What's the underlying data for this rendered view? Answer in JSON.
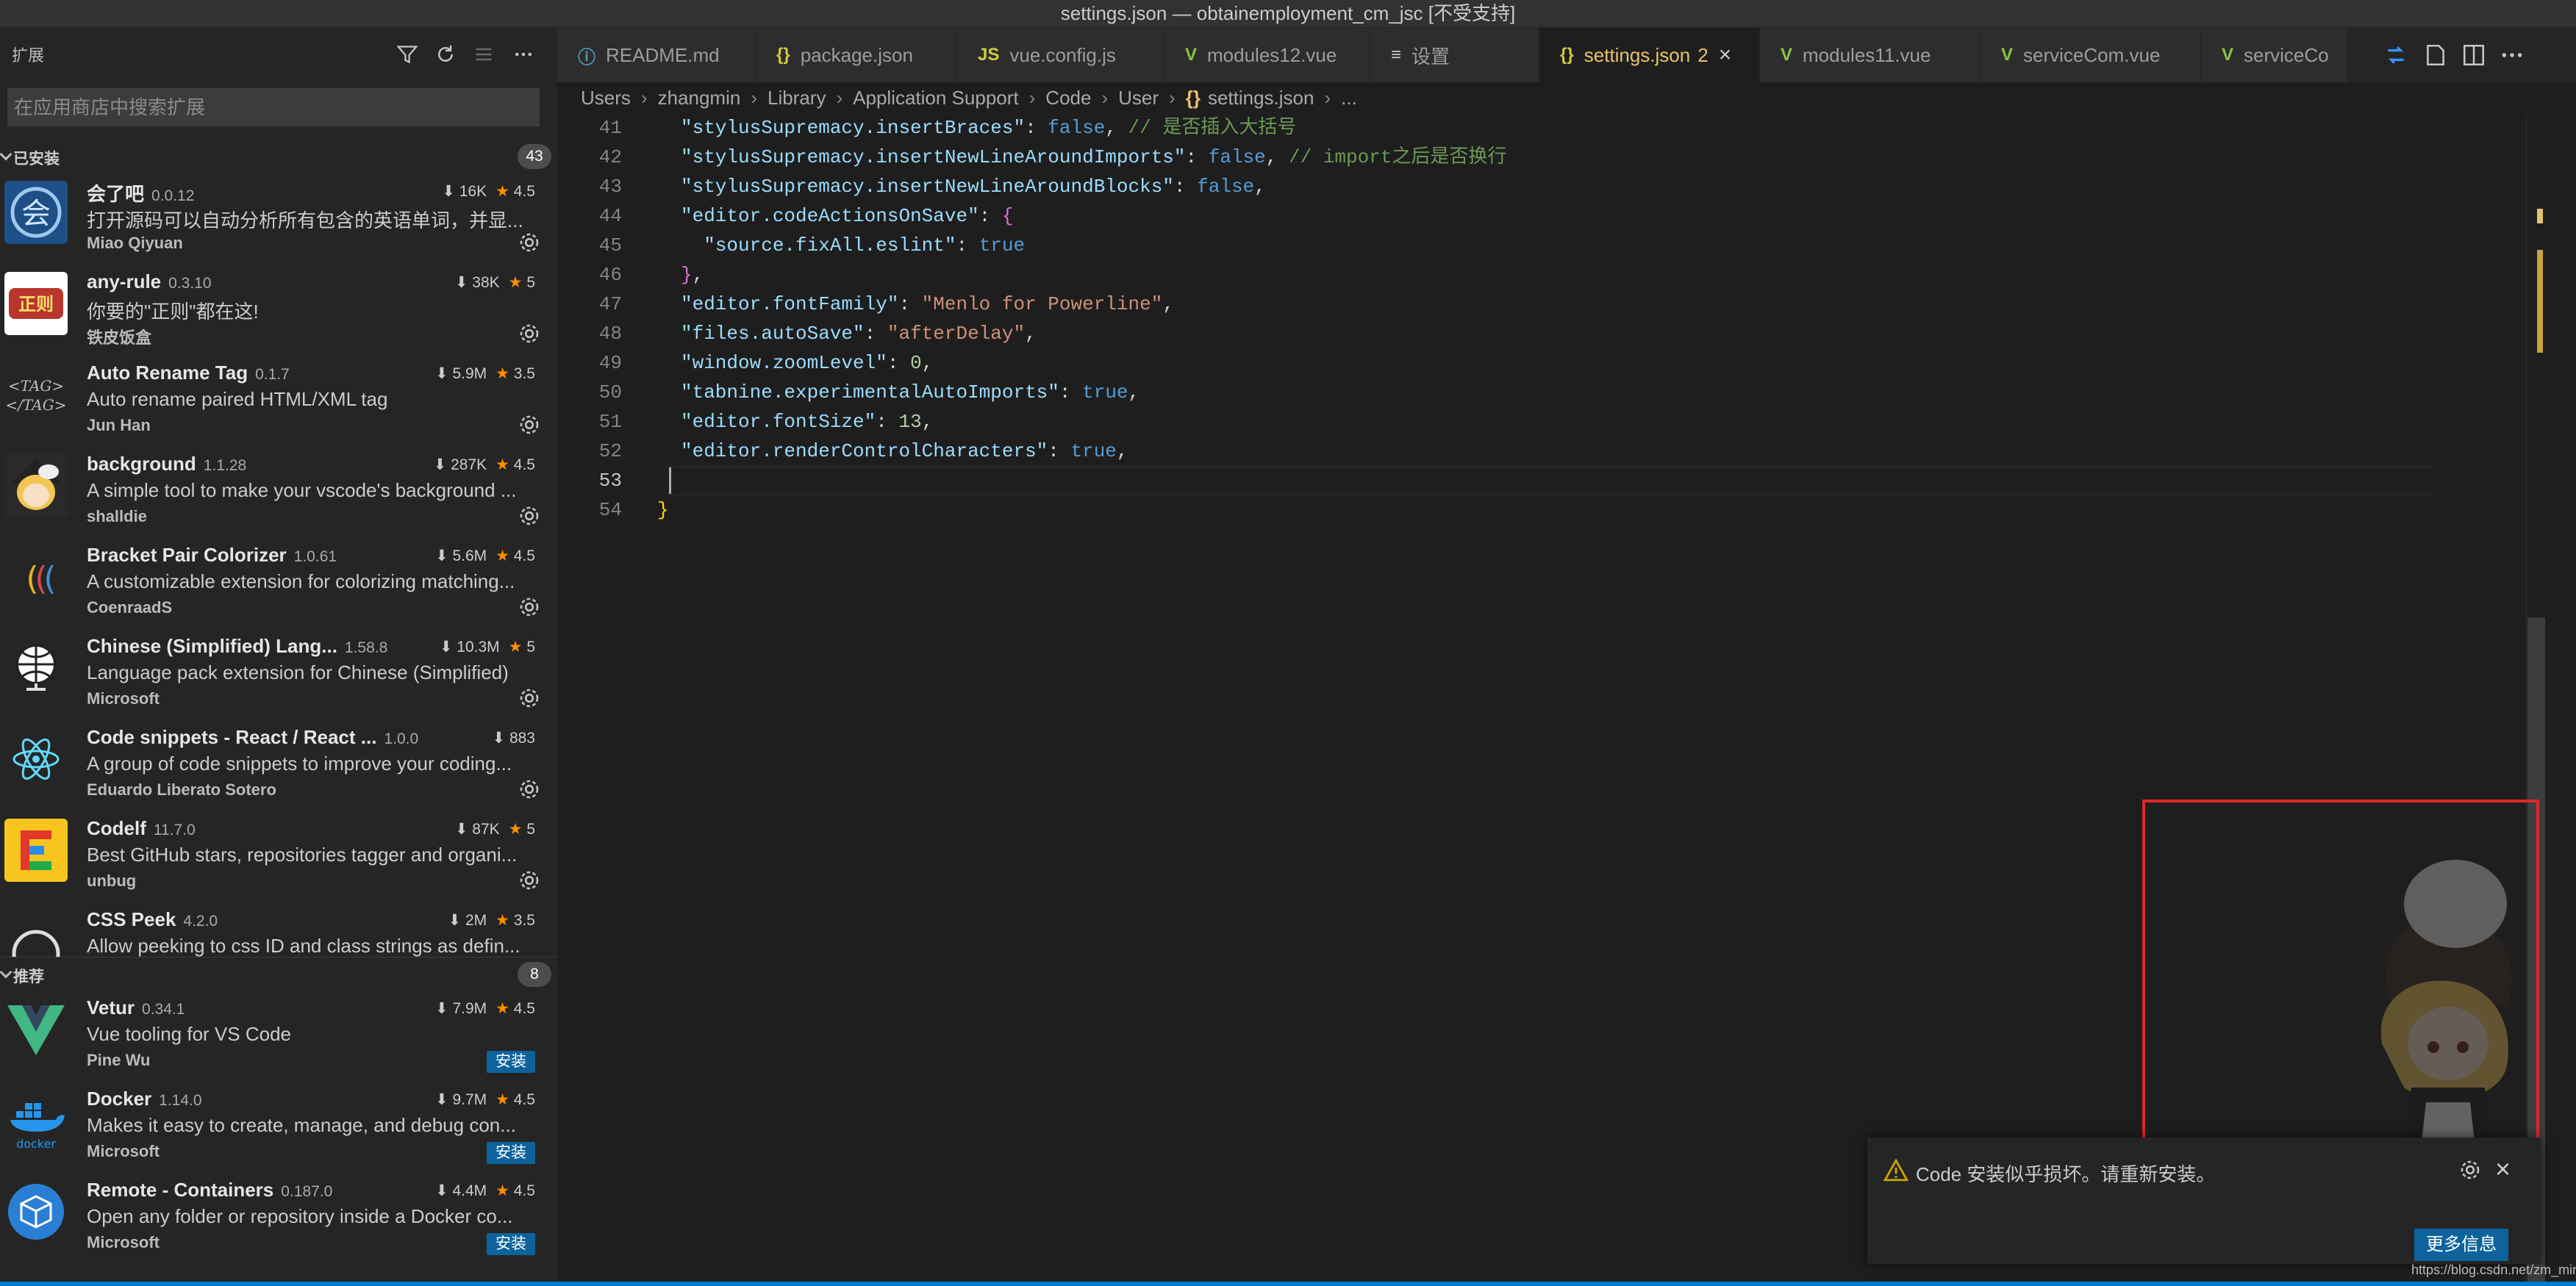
{
  "window": {
    "title": "settings.json — obtainemployment_cm_jsc [不受支持]"
  },
  "sidebar": {
    "title": "扩展",
    "search_placeholder": "在应用商店中搜索扩展",
    "installed": {
      "label": "已安装",
      "count": "43",
      "items": [
        {
          "name": "会了吧",
          "version": "0.0.12",
          "downloads": "16K",
          "rating": "4.5",
          "description": "打开源码可以自动分析所有包含的英语单词，并显...",
          "publisher": "Miao Qiyuan",
          "icon": "hui-le-ba-icon"
        },
        {
          "name": "any-rule",
          "version": "0.3.10",
          "downloads": "38K",
          "rating": "5",
          "description": "你要的\"正则\"都在这!",
          "publisher": "铁皮饭盒",
          "icon": "any-rule-icon"
        },
        {
          "name": "Auto Rename Tag",
          "version": "0.1.7",
          "downloads": "5.9M",
          "rating": "3.5",
          "description": "Auto rename paired HTML/XML tag",
          "publisher": "Jun Han",
          "icon": "tag-icon"
        },
        {
          "name": "background",
          "version": "1.1.28",
          "downloads": "287K",
          "rating": "4.5",
          "description": "A simple tool to make your vscode's background ...",
          "publisher": "shalldie",
          "icon": "anime-girl-icon"
        },
        {
          "name": "Bracket Pair Colorizer",
          "version": "1.0.61",
          "downloads": "5.6M",
          "rating": "4.5",
          "description": "A customizable extension for colorizing matching...",
          "publisher": "CoenraadS",
          "icon": "bracket-icon"
        },
        {
          "name": "Chinese (Simplified) Lang...",
          "version": "1.58.8",
          "downloads": "10.3M",
          "rating": "5",
          "description": "Language pack extension for Chinese (Simplified)",
          "publisher": "Microsoft",
          "icon": "globe-icon"
        },
        {
          "name": "Code snippets - React / React ...",
          "version": "1.0.0",
          "downloads": "883",
          "rating": "",
          "description": "A group of code snippets to improve your coding...",
          "publisher": "Eduardo Liberato Sotero",
          "icon": "react-icon"
        },
        {
          "name": "Codelf",
          "version": "11.7.0",
          "downloads": "87K",
          "rating": "5",
          "description": "Best GitHub stars, repositories tagger and organi...",
          "publisher": "unbug",
          "icon": "codelf-icon"
        },
        {
          "name": "CSS Peek",
          "version": "4.2.0",
          "downloads": "2M",
          "rating": "3.5",
          "description": "Allow peeking to css ID and class strings as defin...",
          "publisher": "",
          "icon": "css-peek-icon"
        }
      ]
    },
    "recommended": {
      "label": "推荐",
      "count": "8",
      "install_label": "安装",
      "items": [
        {
          "name": "Vetur",
          "version": "0.34.1",
          "downloads": "7.9M",
          "rating": "4.5",
          "description": "Vue tooling for VS Code",
          "publisher": "Pine Wu",
          "icon": "vue-icon"
        },
        {
          "name": "Docker",
          "version": "1.14.0",
          "downloads": "9.7M",
          "rating": "4.5",
          "description": "Makes it easy to create, manage, and debug con...",
          "publisher": "Microsoft",
          "icon": "docker-icon"
        },
        {
          "name": "Remote - Containers",
          "version": "0.187.0",
          "downloads": "4.4M",
          "rating": "4.5",
          "description": "Open any folder or repository inside a Docker co...",
          "publisher": "Microsoft",
          "icon": "container-icon"
        }
      ]
    }
  },
  "tabs": [
    {
      "label": "README.md",
      "icon": "ⓘ",
      "icon_color": "#519aba"
    },
    {
      "label": "package.json",
      "icon": "{}",
      "icon_color": "#cbcb41"
    },
    {
      "label": "vue.config.js",
      "icon": "JS",
      "icon_color": "#cbcb41"
    },
    {
      "label": "modules12.vue",
      "icon": "V",
      "icon_color": "#8dc149"
    },
    {
      "label": "设置",
      "icon": "≡",
      "icon_color": "#cccccc"
    },
    {
      "label": "settings.json",
      "icon": "{}",
      "icon_color": "#cbcb41",
      "problems": "2",
      "active": true
    },
    {
      "label": "modules11.vue",
      "icon": "V",
      "icon_color": "#8dc149"
    },
    {
      "label": "serviceCom.vue",
      "icon": "V",
      "icon_color": "#8dc149"
    },
    {
      "label": "serviceCo",
      "icon": "V",
      "icon_color": "#8dc149"
    }
  ],
  "breadcrumb": [
    "Users",
    "zhangmin",
    "Library",
    "Application Support",
    "Code",
    "User",
    "settings.json",
    "..."
  ],
  "editor": {
    "lines": [
      {
        "n": "41",
        "tokens": [
          [
            "k",
            "\"stylusSupremacy.insertBraces\""
          ],
          [
            "p",
            ": "
          ],
          [
            "b",
            "false"
          ],
          [
            "p",
            ", "
          ],
          [
            "c",
            "// 是否插入大括号"
          ]
        ]
      },
      {
        "n": "42",
        "tokens": [
          [
            "k",
            "\"stylusSupremacy.insertNewLineAroundImports\""
          ],
          [
            "p",
            ": "
          ],
          [
            "b",
            "false"
          ],
          [
            "p",
            ", "
          ],
          [
            "c",
            "// import之后是否换行"
          ]
        ]
      },
      {
        "n": "43",
        "tokens": [
          [
            "k",
            "\"stylusSupremacy.insertNewLineAroundBlocks\""
          ],
          [
            "p",
            ": "
          ],
          [
            "b",
            "false"
          ],
          [
            "p",
            ","
          ]
        ]
      },
      {
        "n": "44",
        "tokens": [
          [
            "k",
            "\"editor.codeActionsOnSave\""
          ],
          [
            "p",
            ": "
          ],
          [
            "br2",
            "{"
          ]
        ]
      },
      {
        "n": "45",
        "tokens": [
          [
            "p",
            "  "
          ],
          [
            "k",
            "\"source.fixAll.eslint\""
          ],
          [
            "p",
            ": "
          ],
          [
            "b",
            "true"
          ]
        ]
      },
      {
        "n": "46",
        "tokens": [
          [
            "br2",
            "}"
          ],
          [
            "p",
            ","
          ]
        ]
      },
      {
        "n": "47",
        "tokens": [
          [
            "k",
            "\"editor.fontFamily\""
          ],
          [
            "p",
            ": "
          ],
          [
            "s",
            "\"Menlo for Powerline\""
          ],
          [
            "p",
            ","
          ]
        ]
      },
      {
        "n": "48",
        "tokens": [
          [
            "k",
            "\"files.autoSave\""
          ],
          [
            "p",
            ": "
          ],
          [
            "s",
            "\"afterDelay\""
          ],
          [
            "p",
            ","
          ]
        ]
      },
      {
        "n": "49",
        "tokens": [
          [
            "k",
            "\"window.zoomLevel\""
          ],
          [
            "p",
            ": "
          ],
          [
            "num",
            "0"
          ],
          [
            "p",
            ","
          ]
        ]
      },
      {
        "n": "50",
        "tokens": [
          [
            "k",
            "\"tabnine.experimentalAutoImports\""
          ],
          [
            "p",
            ": "
          ],
          [
            "b",
            "true"
          ],
          [
            "p",
            ","
          ]
        ]
      },
      {
        "n": "51",
        "tokens": [
          [
            "k",
            "\"editor.fontSize\""
          ],
          [
            "p",
            ": "
          ],
          [
            "num",
            "13"
          ],
          [
            "p",
            ","
          ]
        ]
      },
      {
        "n": "52",
        "tokens": [
          [
            "k",
            "\"editor.renderControlCharacters\""
          ],
          [
            "p",
            ": "
          ],
          [
            "b",
            "true"
          ],
          [
            "p",
            ","
          ]
        ]
      },
      {
        "n": "53",
        "tokens": [],
        "current": true
      },
      {
        "n": "54",
        "tokens": [
          [
            "br1",
            "}"
          ]
        ],
        "outdent": true
      }
    ]
  },
  "notification": {
    "message": "Code 安装似乎损坏。请重新安装。",
    "button": "更多信息",
    "close": "×"
  },
  "watermark": "https://blog.csdn.net/zm_miner"
}
